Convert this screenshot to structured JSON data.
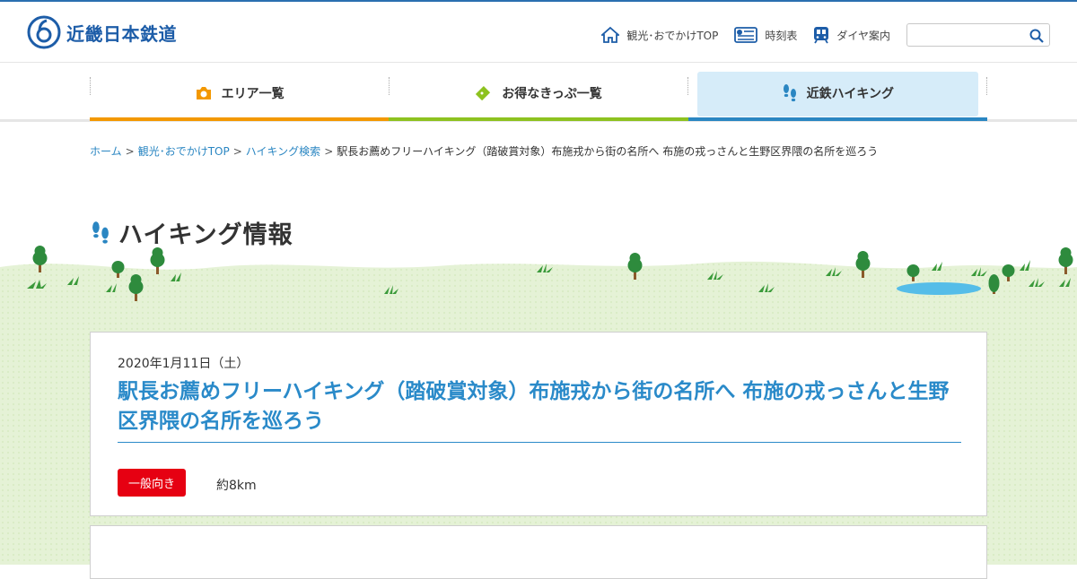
{
  "header": {
    "logo_text": "近畿日本鉄道",
    "util_links": [
      {
        "label": "観光･おでかけTOP",
        "icon": "home-icon"
      },
      {
        "label": "時刻表",
        "icon": "timetable-icon"
      },
      {
        "label": "ダイヤ案内",
        "icon": "train-icon"
      }
    ],
    "search_placeholder": ""
  },
  "gnav": {
    "items": [
      {
        "label": "エリア一覧",
        "icon": "camera-icon",
        "color": "#f39800"
      },
      {
        "label": "お得なきっぷ一覧",
        "icon": "ticket-icon",
        "color": "#8dc21f"
      },
      {
        "label": "近鉄ハイキング",
        "icon": "footprints-icon",
        "color": "#2a86c2",
        "active": true
      }
    ]
  },
  "breadcrumb": {
    "links": [
      "ホーム",
      "観光･おでかけTOP",
      "ハイキング検索"
    ],
    "current": "駅長お薦めフリーハイキング（踏破賞対象）布施戎から街の名所へ 布施の戎っさんと生野区界隈の名所を巡ろう",
    "separator": ">"
  },
  "page": {
    "title": "ハイキング情報"
  },
  "event": {
    "date": "2020年1月11日（土）",
    "title": "駅長お薦めフリーハイキング（踏破賞対象）布施戎から街の名所へ 布施の戎っさんと生野区界隈の名所を巡ろう",
    "tag": "一般向き",
    "distance": "約8km",
    "title_color": "#2a8ac9",
    "tag_color": "#e60012"
  }
}
